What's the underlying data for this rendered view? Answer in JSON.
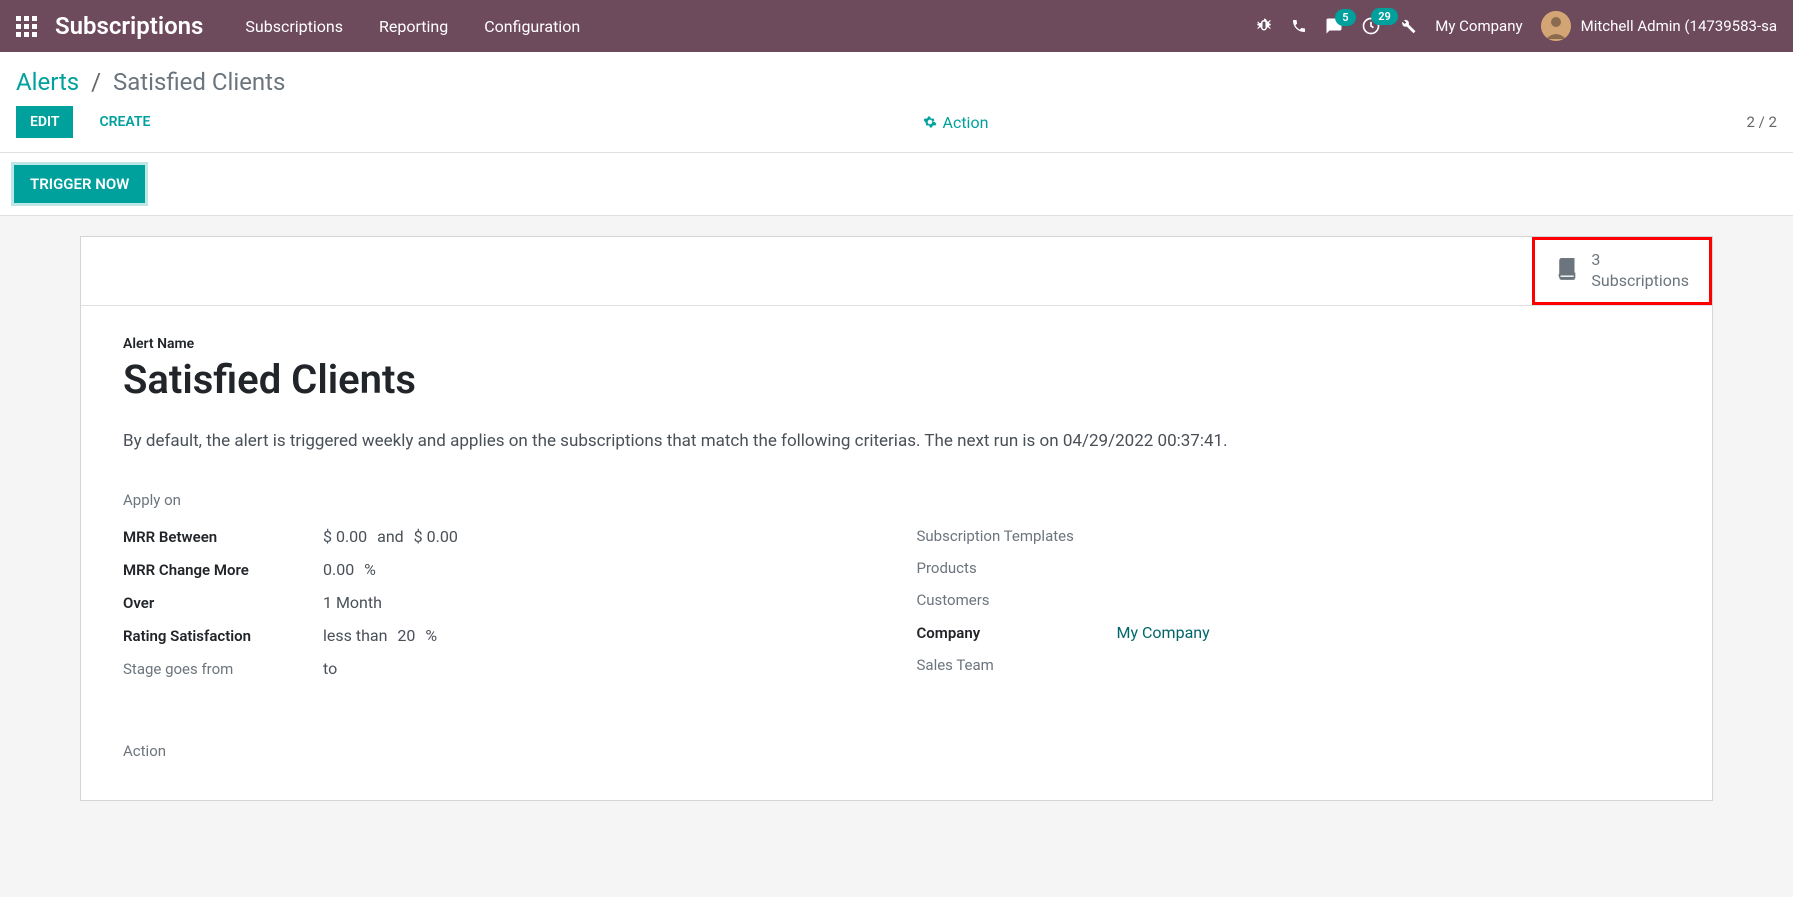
{
  "navbar": {
    "app_name": "Subscriptions",
    "menu": [
      "Subscriptions",
      "Reporting",
      "Configuration"
    ],
    "badges": {
      "chat": "5",
      "clock": "29"
    },
    "company": "My Company",
    "user": "Mitchell Admin (14739583-sa"
  },
  "breadcrumb": {
    "parent": "Alerts",
    "current": "Satisfied Clients"
  },
  "controls": {
    "edit": "Edit",
    "create": "Create",
    "action": "Action",
    "pager": "2 / 2",
    "trigger": "Trigger Now"
  },
  "stat_button": {
    "count": "3",
    "label": "Subscriptions"
  },
  "form": {
    "alert_name_label": "Alert Name",
    "alert_name_value": "Satisfied Clients",
    "description": "By default, the alert is triggered weekly and applies on the subscriptions that match the following criterias. The next run is on 04/29/2022 00:37:41.",
    "apply_on_title": "Apply on",
    "left_fields": {
      "mrr_between": {
        "label": "MRR Between",
        "from": "$ 0.00",
        "joiner": "and",
        "to": "$ 0.00"
      },
      "mrr_change": {
        "label": "MRR Change More",
        "value": "0.00",
        "unit": "%"
      },
      "over": {
        "label": "Over",
        "value": "1 Month"
      },
      "rating": {
        "label": "Rating Satisfaction",
        "op": "less than",
        "value": "20",
        "unit": "%"
      },
      "stage": {
        "label": "Stage goes from",
        "to_label": "to"
      }
    },
    "right_fields": {
      "templates": "Subscription Templates",
      "products": "Products",
      "customers": "Customers",
      "company_label": "Company",
      "company_value": "My Company",
      "sales_team": "Sales Team"
    },
    "action_title": "Action"
  }
}
